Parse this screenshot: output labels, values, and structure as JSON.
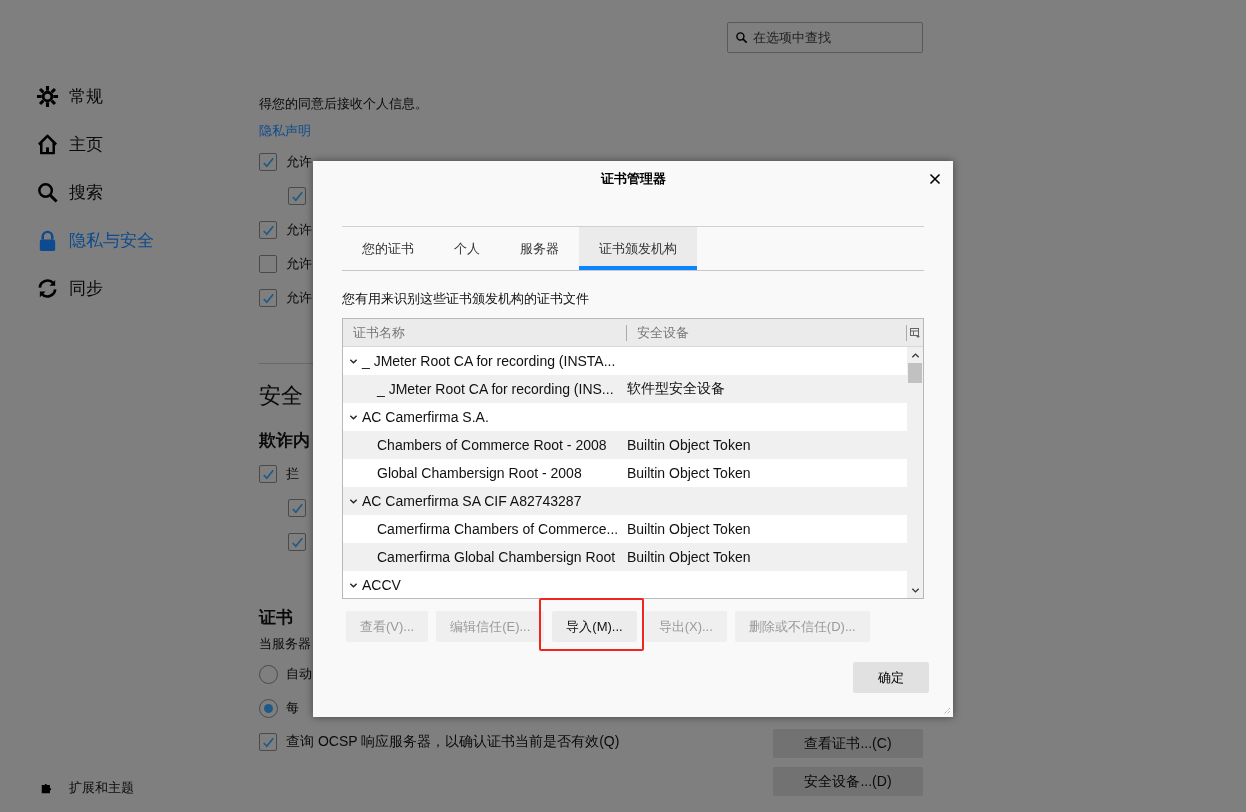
{
  "search": {
    "placeholder": "在选项中查找"
  },
  "sidebar": {
    "items": [
      {
        "label": "常规",
        "kind": "gear",
        "selected": false
      },
      {
        "label": "主页",
        "kind": "home",
        "selected": false
      },
      {
        "label": "搜索",
        "kind": "search",
        "selected": false
      },
      {
        "label": "隐私与安全",
        "kind": "lock",
        "selected": true
      },
      {
        "label": "同步",
        "kind": "sync",
        "selected": false
      }
    ],
    "footer": {
      "label": "扩展和主题"
    }
  },
  "privacy": {
    "text": "得您的同意后接收个人信息。",
    "link": "隐私声明",
    "options": [
      {
        "label": "允许",
        "checked": true,
        "children": [
          {
            "checked": true
          }
        ]
      },
      {
        "label": "允许",
        "checked": true
      },
      {
        "label": "允许",
        "checked": false
      },
      {
        "label": "允许",
        "checked": true
      }
    ]
  },
  "security": {
    "heading": "安全",
    "subheading": "欺诈内",
    "options": [
      {
        "label": "拦",
        "checked": true,
        "children": [
          {
            "checked": true
          },
          {
            "checked": true
          }
        ]
      }
    ]
  },
  "certificates": {
    "heading": "证书",
    "text": "当服务器",
    "radios": [
      {
        "label": "自动",
        "selected": false
      },
      {
        "label": "每",
        "selected": true
      }
    ],
    "ocsp": {
      "label": "查询 OCSP 响应服务器，以确认证书当前是否有效(Q)",
      "checked": true
    },
    "buttons": [
      "查看证书...(C)",
      "安全设备...(D)"
    ]
  },
  "dialog": {
    "title": "证书管理器",
    "tabs": [
      {
        "label": "您的证书",
        "selected": false
      },
      {
        "label": "个人",
        "selected": false
      },
      {
        "label": "服务器",
        "selected": false
      },
      {
        "label": "证书颁发机构",
        "selected": true
      }
    ],
    "description": "您有用来识别这些证书颁发机构的证书文件",
    "columns": [
      "证书名称",
      "安全设备"
    ],
    "rows": [
      {
        "name": "_ JMeter Root CA for recording (INSTA...",
        "expanded": true,
        "children": [
          {
            "name": "_ JMeter Root CA for recording (INS...",
            "device": "软件型安全设备"
          }
        ]
      },
      {
        "name": "AC Camerfirma S.A.",
        "expanded": true,
        "children": [
          {
            "name": "Chambers of Commerce Root - 2008",
            "device": "Builtin Object Token"
          },
          {
            "name": "Global Chambersign Root - 2008",
            "device": "Builtin Object Token"
          }
        ]
      },
      {
        "name": "AC Camerfirma SA CIF A82743287",
        "expanded": true,
        "children": [
          {
            "name": "Camerfirma Chambers of Commerce...",
            "device": "Builtin Object Token"
          },
          {
            "name": "Camerfirma Global Chambersign Root",
            "device": "Builtin Object Token"
          }
        ]
      },
      {
        "name": "ACCV",
        "expanded": true
      }
    ],
    "buttons": [
      {
        "label": "查看(V)...",
        "disabled": true,
        "highlighted": false
      },
      {
        "label": "编辑信任(E)...",
        "disabled": true,
        "highlighted": false
      },
      {
        "label": "导入(M)...",
        "disabled": false,
        "highlighted": true
      },
      {
        "label": "导出(X)...",
        "disabled": true,
        "highlighted": false
      },
      {
        "label": "删除或不信任(D)...",
        "disabled": true,
        "highlighted": false
      }
    ],
    "ok": "确定"
  }
}
